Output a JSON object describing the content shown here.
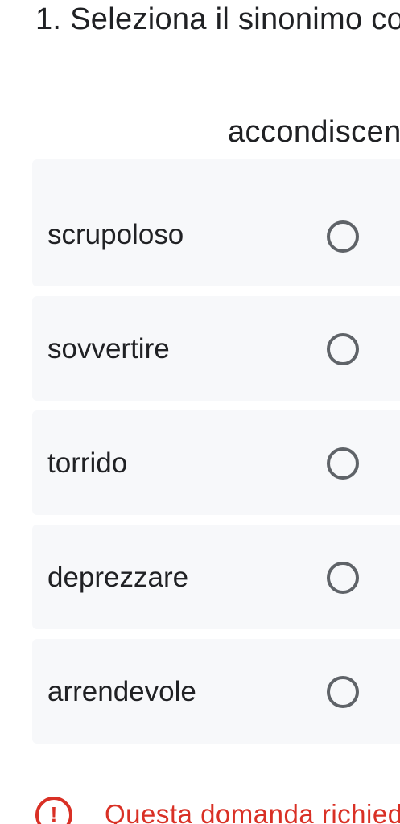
{
  "question": {
    "number_title": "1. Seleziona il sinonimo co",
    "prompt_word": "accondiscend"
  },
  "options": [
    {
      "label": "scrupoloso",
      "selected": false
    },
    {
      "label": "sovvertire",
      "selected": false
    },
    {
      "label": "torrido",
      "selected": false
    },
    {
      "label": "deprezzare",
      "selected": false
    },
    {
      "label": "arrendevole",
      "selected": false
    }
  ],
  "validation": {
    "icon": "exclamation-circle-icon",
    "icon_glyph": "!",
    "message": "Questa domanda richiede",
    "color": "#d93025"
  },
  "colors": {
    "option_background": "#f7f8fa",
    "radio_border": "#5f6368",
    "text": "#202124"
  }
}
